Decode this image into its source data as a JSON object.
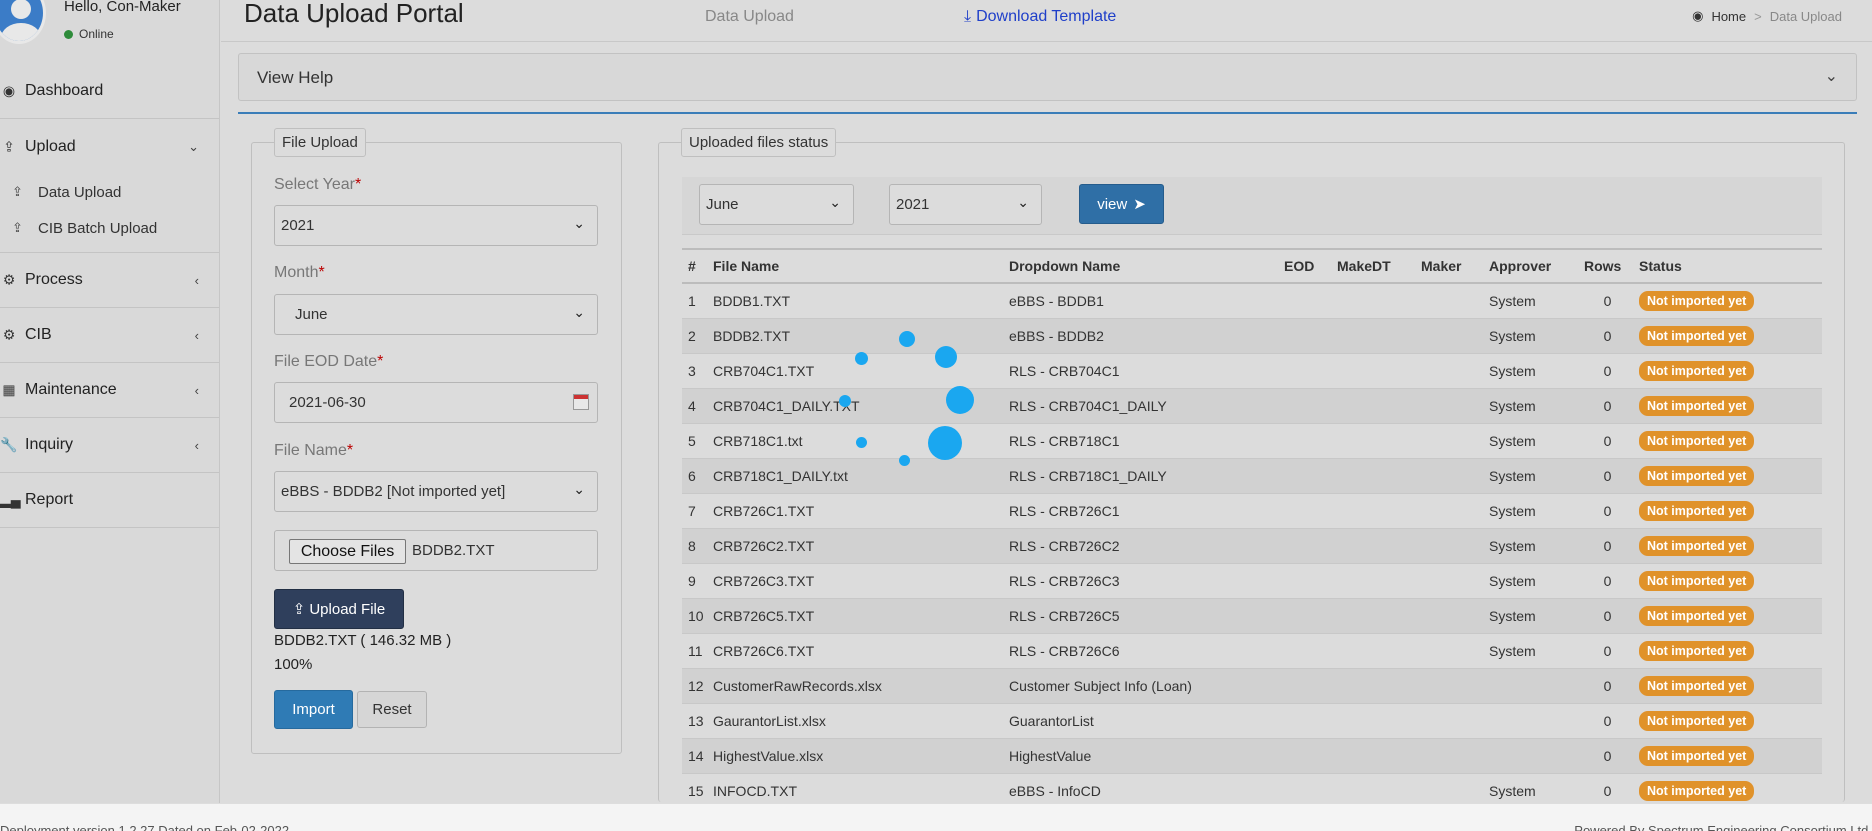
{
  "user": {
    "greeting": "Hello, Con-Maker",
    "status": "Online"
  },
  "sidebar": {
    "items": [
      {
        "label": "Dashboard",
        "icon": "dashboard-icon"
      },
      {
        "label": "Upload",
        "icon": "upload-icon"
      },
      {
        "label": "Process",
        "icon": "gears-icon"
      },
      {
        "label": "CIB",
        "icon": "gears-icon"
      },
      {
        "label": "Maintenance",
        "icon": "grid-icon"
      },
      {
        "label": "Inquiry",
        "icon": "wrench-icon"
      },
      {
        "label": "Report",
        "icon": "bar-chart-icon"
      }
    ],
    "upload_sub": [
      {
        "label": "Data Upload"
      },
      {
        "label": "CIB Batch Upload"
      }
    ]
  },
  "header": {
    "title": "Data Upload Portal",
    "subtitle": "Data Upload",
    "download_label": "Download Template",
    "breadcrumb": {
      "home": "Home",
      "separator": ">",
      "current": "Data Upload"
    }
  },
  "help": {
    "title": "View Help"
  },
  "upload_form": {
    "legend": "File Upload",
    "year_label": "Select Year",
    "year_value": "2021",
    "month_label": "Month",
    "month_value": "June",
    "eod_label": "File EOD Date",
    "eod_value": "2021-06-30",
    "file_name_label": "File Name",
    "file_name_value": "eBBS - BDDB2 [Not imported yet]",
    "choose_label": "Choose Files",
    "chosen_file": "BDDB2.TXT",
    "upload_label": "Upload File",
    "upload_info": "BDDB2.TXT ( 146.32 MB )",
    "progress_text": "100%",
    "progress": 1.0,
    "import_label": "Import",
    "reset_label": "Reset",
    "required_mark": "*"
  },
  "status_panel": {
    "legend": "Uploaded files status",
    "month": "June",
    "year": "2021",
    "view_label": "view",
    "columns": [
      "#",
      "File Name",
      "Dropdown Name",
      "EOD",
      "MakeDT",
      "Maker",
      "Approver",
      "Rows",
      "Status"
    ],
    "rows": [
      {
        "n": "1",
        "file": "BDDB1.TXT",
        "dropdown": "eBBS - BDDB1",
        "approver": "System",
        "rows": "0",
        "status": "Not imported yet"
      },
      {
        "n": "2",
        "file": "BDDB2.TXT",
        "dropdown": "eBBS - BDDB2",
        "approver": "System",
        "rows": "0",
        "status": "Not imported yet"
      },
      {
        "n": "3",
        "file": "CRB704C1.TXT",
        "dropdown": "RLS - CRB704C1",
        "approver": "System",
        "rows": "0",
        "status": "Not imported yet"
      },
      {
        "n": "4",
        "file": "CRB704C1_DAILY.TXT",
        "dropdown": "RLS - CRB704C1_DAILY",
        "approver": "System",
        "rows": "0",
        "status": "Not imported yet"
      },
      {
        "n": "5",
        "file": "CRB718C1.txt",
        "dropdown": "RLS - CRB718C1",
        "approver": "System",
        "rows": "0",
        "status": "Not imported yet"
      },
      {
        "n": "6",
        "file": "CRB718C1_DAILY.txt",
        "dropdown": "RLS - CRB718C1_DAILY",
        "approver": "System",
        "rows": "0",
        "status": "Not imported yet"
      },
      {
        "n": "7",
        "file": "CRB726C1.TXT",
        "dropdown": "RLS - CRB726C1",
        "approver": "System",
        "rows": "0",
        "status": "Not imported yet"
      },
      {
        "n": "8",
        "file": "CRB726C2.TXT",
        "dropdown": "RLS - CRB726C2",
        "approver": "System",
        "rows": "0",
        "status": "Not imported yet"
      },
      {
        "n": "9",
        "file": "CRB726C3.TXT",
        "dropdown": "RLS - CRB726C3",
        "approver": "System",
        "rows": "0",
        "status": "Not imported yet"
      },
      {
        "n": "10",
        "file": "CRB726C5.TXT",
        "dropdown": "RLS - CRB726C5",
        "approver": "System",
        "rows": "0",
        "status": "Not imported yet"
      },
      {
        "n": "11",
        "file": "CRB726C6.TXT",
        "dropdown": "RLS - CRB726C6",
        "approver": "System",
        "rows": "0",
        "status": "Not imported yet"
      },
      {
        "n": "12",
        "file": "CustomerRawRecords.xlsx",
        "dropdown": "Customer Subject Info (Loan)",
        "approver": "",
        "rows": "0",
        "status": "Not imported yet"
      },
      {
        "n": "13",
        "file": "GaurantorList.xlsx",
        "dropdown": "GuarantorList",
        "approver": "",
        "rows": "0",
        "status": "Not imported yet"
      },
      {
        "n": "14",
        "file": "HighestValue.xlsx",
        "dropdown": "HighestValue",
        "approver": "",
        "rows": "0",
        "status": "Not imported yet"
      },
      {
        "n": "15",
        "file": "INFOCD.TXT",
        "dropdown": "eBBS - InfoCD",
        "approver": "System",
        "rows": "0",
        "status": "Not imported yet"
      }
    ]
  },
  "footer": {
    "left": "Deployment version 1.2.27 Dated on Feb-02-2022",
    "right": "Powered By Spectrum Engineering Consortium Ltd."
  },
  "colors": {
    "accent": "#2f7bb5",
    "badge": "#e0922a",
    "spinner": "#1aa7f0",
    "link": "#1f3fc9"
  }
}
